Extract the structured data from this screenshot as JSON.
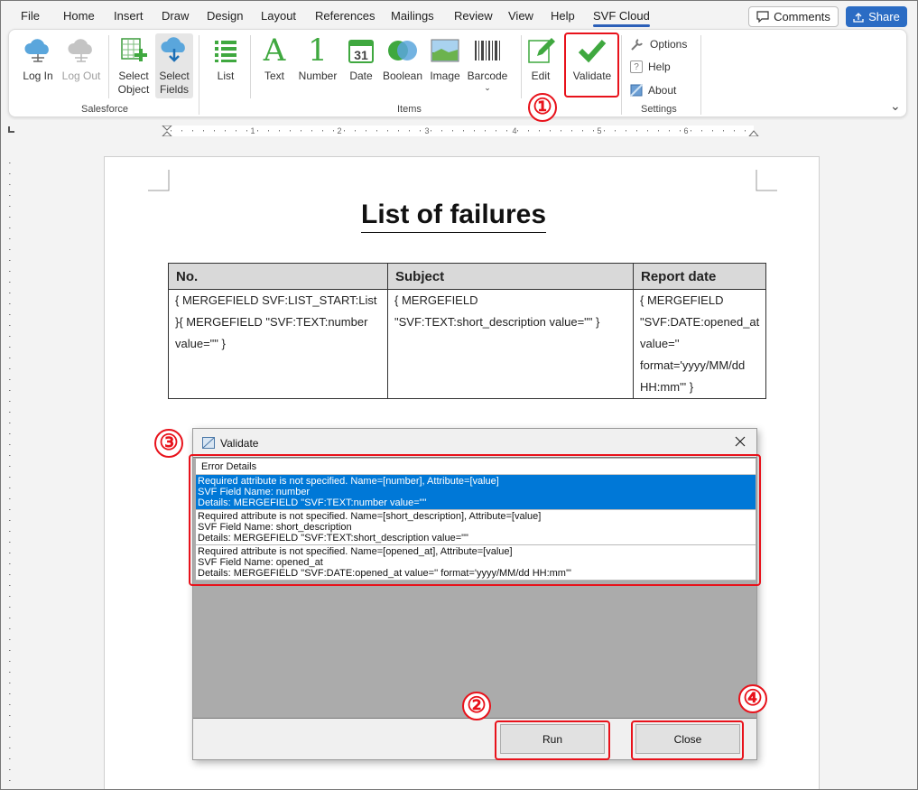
{
  "menu": {
    "tabs": [
      "File",
      "Home",
      "Insert",
      "Draw",
      "Design",
      "Layout",
      "References",
      "Mailings",
      "Review",
      "View",
      "Help",
      "SVF Cloud"
    ],
    "comments_label": "Comments",
    "share_label": "Share"
  },
  "ribbon": {
    "salesforce": {
      "login": "Log In",
      "logout": "Log Out",
      "select_object_1": "Select",
      "select_object_2": "Object",
      "select_fields_1": "Select",
      "select_fields_2": "Fields",
      "group": "Salesforce"
    },
    "items": {
      "list": "List",
      "text": "Text",
      "number": "Number",
      "date": "Date",
      "boolean": "Boolean",
      "image": "Image",
      "barcode": "Barcode",
      "group": "Items"
    },
    "edit": "Edit",
    "validate": "Validate",
    "settings": {
      "options": "Options",
      "help": "Help",
      "about": "About",
      "group": "Settings"
    }
  },
  "ruler": {
    "numbers": [
      "1",
      "2",
      "3",
      "4",
      "5",
      "6"
    ]
  },
  "document": {
    "title": "List of failures",
    "table": {
      "headers": [
        "No.",
        "Subject",
        "Report date"
      ],
      "cells": [
        "{ MERGEFIELD SVF:LIST_START:List }{ MERGEFIELD \"SVF:TEXT:number value=\"\" }",
        "{ MERGEFIELD \"SVF:TEXT:short_description value=\"\" }",
        "{ MERGEFIELD \"SVF:DATE:opened_at value='' format='yyyy/MM/dd HH:mm'\" }"
      ]
    }
  },
  "dialog": {
    "title": "Validate",
    "list_header": "Error Details",
    "errors": [
      {
        "line1": "Required attribute is not specified. Name=[number], Attribute=[value]",
        "line2": "SVF Field Name: number",
        "line3": "Details:  MERGEFIELD \"SVF:TEXT:number value=\"\""
      },
      {
        "line1": "Required attribute is not specified. Name=[short_description], Attribute=[value]",
        "line2": "SVF Field Name: short_description",
        "line3": "Details:  MERGEFIELD \"SVF:TEXT:short_description value=\"\""
      },
      {
        "line1": "Required attribute is not specified. Name=[opened_at], Attribute=[value]",
        "line2": "SVF Field Name: opened_at",
        "line3": "Details:  MERGEFIELD \"SVF:DATE:opened_at value='' format='yyyy/MM/dd HH:mm'\""
      }
    ],
    "run_label": "Run",
    "close_label": "Close"
  },
  "callouts": {
    "m1": "①",
    "m2": "②",
    "m3": "③",
    "m4": "④"
  },
  "colors": {
    "accent_red": "#e8121b",
    "selection_blue": "#0078d7",
    "share_blue": "#2b6cc4"
  }
}
